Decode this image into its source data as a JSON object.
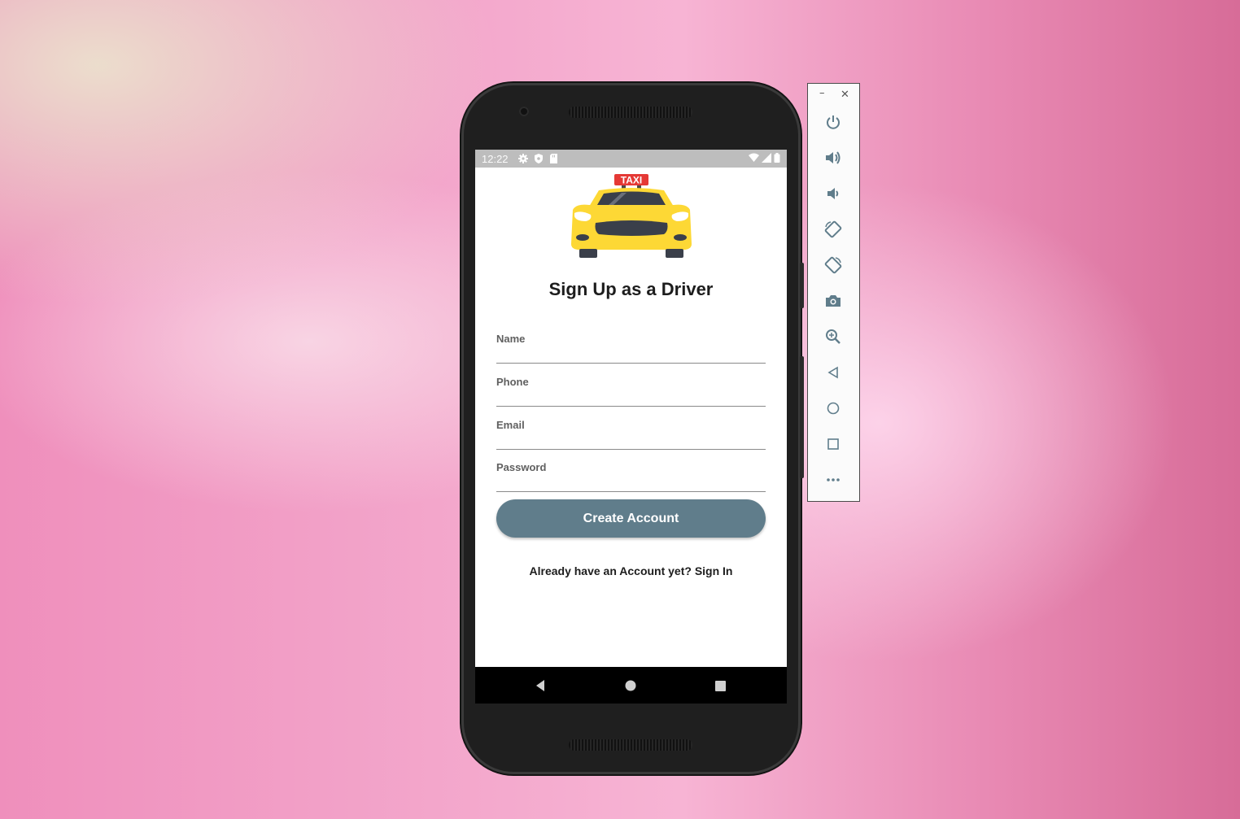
{
  "statusbar": {
    "time": "12:22"
  },
  "app": {
    "logo_sign": "TAXI",
    "title": "Sign Up as a Driver",
    "fields": {
      "name_label": "Name",
      "phone_label": "Phone",
      "email_label": "Email",
      "password_label": "Password"
    },
    "create_button": "Create Account",
    "signin_prompt": "Already have an Account yet? Sign In"
  },
  "emulator_toolbar": {
    "buttons": [
      "power-icon",
      "volume-up-icon",
      "volume-down-icon",
      "rotate-left-icon",
      "rotate-right-icon",
      "camera-icon",
      "zoom-icon",
      "back-icon",
      "home-icon",
      "overview-icon",
      "more-icon"
    ],
    "window_controls": [
      "minimize-icon",
      "close-icon"
    ]
  },
  "colors": {
    "button": "#607d8b",
    "taxi_yellow": "#fdd835",
    "taxi_sign": "#e53935",
    "statusbar": "#bdbdbd"
  }
}
